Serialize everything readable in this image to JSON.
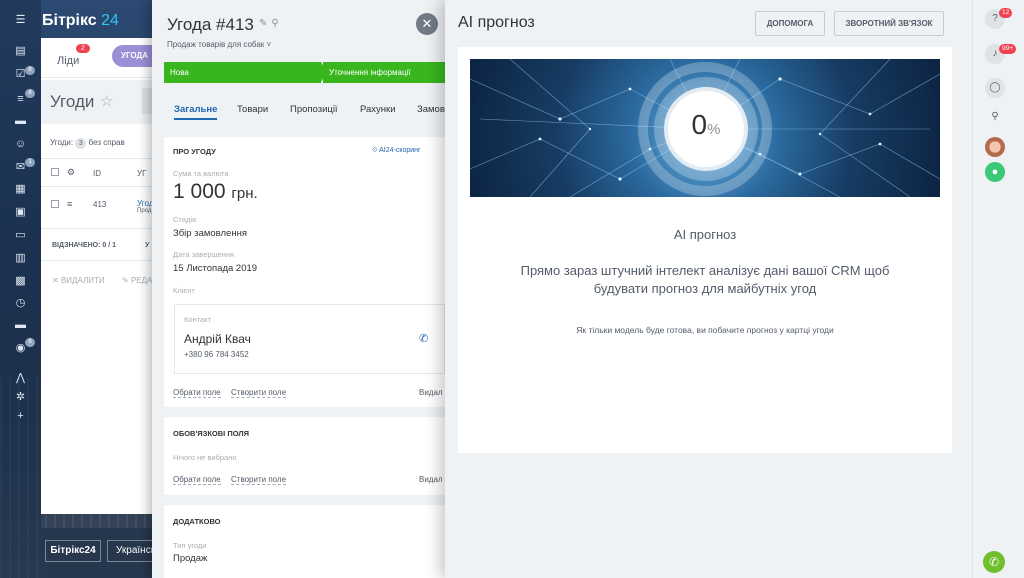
{
  "portal": {
    "logo_main": "Бітрікс",
    "logo_num": "24",
    "tabs": {
      "leads_label": "Ліди",
      "leads_count": "2",
      "deals_label": "УГОДА"
    },
    "page_title": "Угоди",
    "filter_summary": {
      "label": "Угоди:",
      "count": "3",
      "no_tasks": "без справ"
    },
    "table": {
      "col_id": "ID",
      "col_name": "УГ",
      "row_id": "413",
      "row_name": "Угод",
      "row_sub": "Прод"
    },
    "selected": "ВІДЗНАЧЕНО: 0 / 1",
    "selected_trail": "У",
    "actions": {
      "delete": "ВИДАЛИТИ",
      "edit": "РЕДА"
    },
    "nav_badges": [
      "8",
      "8",
      "1",
      "8"
    ],
    "footer": {
      "logo": "Бітрікс24",
      "lang": "Українсь"
    }
  },
  "deal": {
    "title": "Угода #413",
    "pipeline": "Продаж товарів для собак",
    "stages": [
      "Нова",
      "Уточнення інформації"
    ],
    "tabs": [
      "Загальне",
      "Товари",
      "Пропозиції",
      "Рахунки",
      "Замов"
    ],
    "about": {
      "header": "ПРО УГОДУ",
      "scoring": "AI24-скоринг",
      "amount_label": "Сума та валюта",
      "amount": "1 000",
      "currency": "грн.",
      "stage_label": "Стадія",
      "stage_value": "Збір замовлення",
      "close_label": "Дата завершення",
      "close_value": "15 Листопада 2019",
      "client_label": "Клієнт",
      "contact_label": "Контакт",
      "contact_name": "Андрій Квач",
      "contact_phone": "+380 96 784 3452",
      "choose_field": "Обрати поле",
      "create_field": "Створити поле",
      "remove": "Видал"
    },
    "required": {
      "header": "ОБОВ'ЯЗКОВІ ПОЛЯ",
      "none": "Нічого не вибрано",
      "choose_field": "Обрати поле",
      "create_field": "Створити поле",
      "remove": "Видал"
    },
    "extra": {
      "header": "ДОДАТКОВО",
      "type_label": "Тип угоди",
      "type_value": "Продаж"
    }
  },
  "ai": {
    "title": "AI прогноз",
    "help_button": "ДОПОМОГА",
    "feedback_button": "ЗВОРОТНИЙ ЗВ'ЯЗОК",
    "gauge_value": "0",
    "gauge_unit": "%",
    "heading": "AI прогноз",
    "description": "Прямо зараз штучний інтелект аналізує дані вашої CRM щоб будувати прогноз для майбутніх угод",
    "note": "Як тільки модель буде готова, ви побачите прогноз у картці угоди"
  },
  "right_bar": {
    "help_badge": "12",
    "notify_badge": "99+"
  },
  "colors": {
    "accent_blue": "#2067b0",
    "stage_green": "#39b61e",
    "badge_red": "#f0434f",
    "call_green": "#6fbe2c"
  }
}
